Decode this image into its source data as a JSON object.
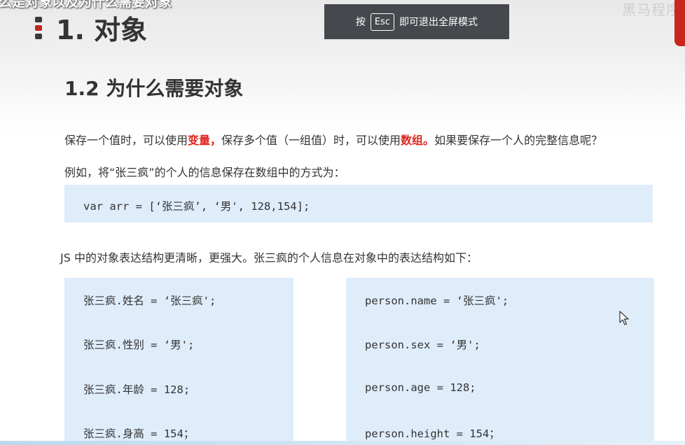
{
  "video_title": "么是对象以及为什么需要对象",
  "section_title": "1. 对象",
  "esc_toast": {
    "prefix": "按",
    "key": "Esc",
    "suffix": "即可退出全屏模式"
  },
  "watermark": "黑马程序",
  "subsection_title": "1.2 为什么需要对象",
  "paragraph1": {
    "part1": "保存一个值时，可以使用",
    "highlight1": "变量，",
    "part2": "保存多个值（一组值）时，可以使用",
    "highlight2": "数组。",
    "part3": "如果要保存一个人的完整信息呢？"
  },
  "paragraph2": "例如，将“张三疯”的个人的信息保存在数组中的方式为：",
  "array_code": "var arr = [‘张三疯’, ‘男', 128,154];",
  "paragraph3": "JS 中的对象表达结构更清晰，更强大。张三疯的个人信息在对象中的表达结构如下：",
  "left_code": [
    "张三疯.姓名 =  ‘张三疯';",
    "张三疯.性别 = ‘男';",
    "张三疯.年龄 = 128;",
    "张三疯.身高 = 154；"
  ],
  "right_code": [
    "person.name =  ‘张三疯';",
    "person.sex = ‘男';",
    "person.age = 128;",
    "person.height = 154；"
  ],
  "colors": {
    "accent_red": "#e0251d",
    "code_bg": "#dfedfb",
    "toast_bg": "#45484d"
  }
}
